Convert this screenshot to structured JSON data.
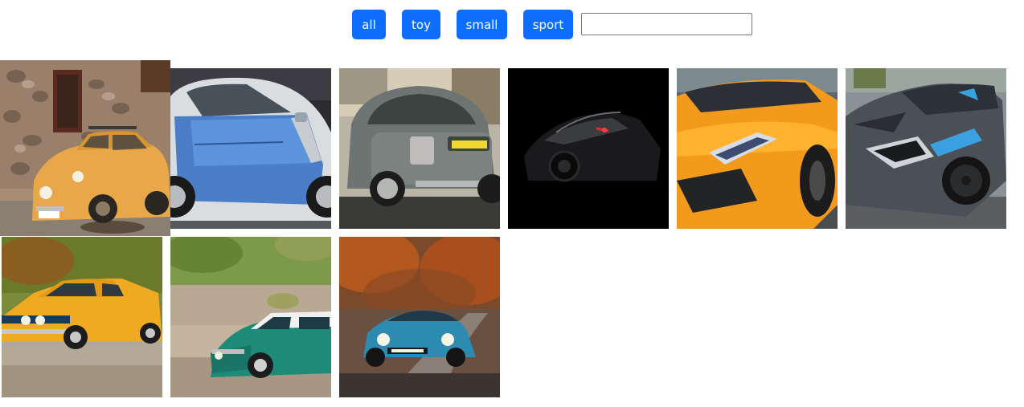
{
  "filters": {
    "all": "all",
    "toy": "toy",
    "small": "small",
    "sport": "sport"
  },
  "search": {
    "value": ""
  },
  "colors": {
    "button_bg": "#0d6efd",
    "button_text": "#ffffff"
  },
  "gallery": {
    "photos": [
      {
        "subject": "yellow-vintage-car-photo"
      },
      {
        "subject": "blue-smart-car-photo"
      },
      {
        "subject": "gray-fiat-500-photo"
      },
      {
        "subject": "dark-sports-car-photo"
      },
      {
        "subject": "orange-lamborghini-photo"
      },
      {
        "subject": "gray-corvette-photo"
      },
      {
        "subject": "yellow-toy-car-photo"
      },
      {
        "subject": "green-toy-mini-photo"
      },
      {
        "subject": "blue-toy-alpine-photo"
      }
    ]
  }
}
